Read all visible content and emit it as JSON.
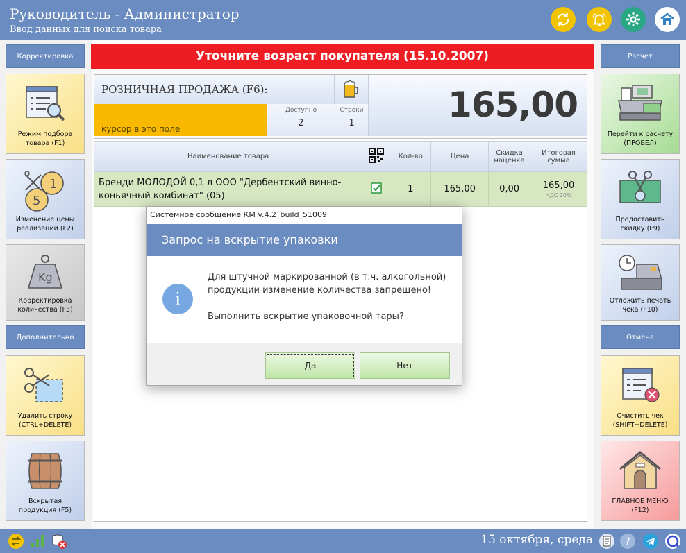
{
  "header": {
    "title": "Руководитель - Администратор",
    "subtitle": "Ввод данных для поиска товара",
    "buttons": [
      {
        "icon": "refresh-icon",
        "color": "#f2c400"
      },
      {
        "icon": "bell-icon",
        "color": "#f2c400"
      },
      {
        "icon": "gear-icon",
        "color": "#2aa784"
      },
      {
        "icon": "home-icon",
        "color": "#ffffff"
      }
    ]
  },
  "banner": {
    "text": "Уточните возраст покупателя (15.10.2007)"
  },
  "sale": {
    "title": "РОЗНИЧНАЯ ПРОДАЖА (F6):",
    "input_placeholder": "курсор в это поле",
    "available_label": "Доступно",
    "available_value": "2",
    "rows_label": "Строки",
    "rows_value": "1",
    "total": "165,00"
  },
  "table": {
    "columns": [
      "Наименование товара",
      "",
      "Кол-во",
      "Цена",
      "Скидка наценка",
      "Итоговая сумма"
    ],
    "rows": [
      {
        "name": "Бренди МОЛОДОЙ 0,1 л ООО \"Дербентский винно-коньячный комбинат\" (05)",
        "qty": "1",
        "price": "165,00",
        "discount": "0,00",
        "total": "165,00",
        "vat": "НДС 20%"
      }
    ]
  },
  "left_panel": {
    "correction_label": "Корректировка",
    "additional_label": "Дополнительно",
    "tiles": [
      {
        "label": "Режим подбора товара (F1)"
      },
      {
        "label": "Изменение цены реализации (F2)"
      },
      {
        "label": "Корректировка количества (F3)"
      },
      {
        "label": "Удалить строку (CTRL+DELETE)"
      },
      {
        "label": "Вскрытая продукция (F5)"
      }
    ]
  },
  "right_panel": {
    "calc_label": "Расчет",
    "cancel_label": "Отмена",
    "tiles": [
      {
        "label": "Перейти к расчету (ПРОБЕЛ)"
      },
      {
        "label": "Предоставить скидку (F9)"
      },
      {
        "label": "Отложить печать чека (F10)"
      },
      {
        "label": "Очистить чек (SHIFT+DELETE)"
      },
      {
        "label": "ГЛАВНОЕ МЕНЮ (F12)"
      }
    ]
  },
  "dialog": {
    "caption": "Системное сообщение КМ v.4.2_build_51009",
    "title": "Запрос на вскрытие упаковки",
    "line1": "Для штучной маркированной (в т.ч. алкогольной) продукции изменение количества запрещено!",
    "line2": "Выполнить вскрытие упаковочной тары?",
    "yes": "Да",
    "no": "Нет"
  },
  "footer": {
    "date": "15 октября, среда"
  }
}
